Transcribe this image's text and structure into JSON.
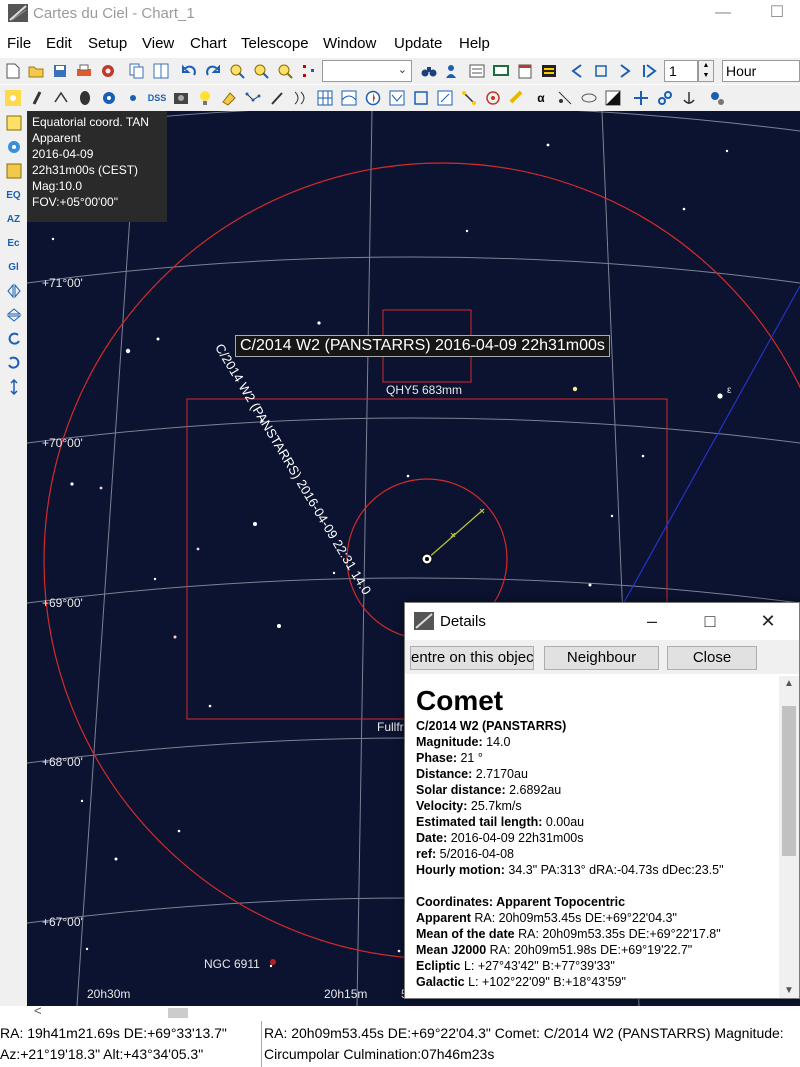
{
  "window": {
    "title": "Cartes du Ciel - Chart_1",
    "minimize_glyph": "—",
    "maximize_glyph": "☐"
  },
  "menu": [
    "File",
    "Edit",
    "Setup",
    "View",
    "Chart",
    "Telescope",
    "Window",
    "Update",
    "Help"
  ],
  "toolbar": {
    "spin_value": "1",
    "time_unit": "Hour",
    "dss_label": "DSS",
    "alpha_label": "α",
    "spin_up": "▲",
    "spin_down": "▼",
    "combo_arrow": "⌄"
  },
  "left_toolbar": [
    "EQ",
    "AZ",
    "Ec",
    "Gl"
  ],
  "chart": {
    "info": [
      "Equatorial coord. TAN",
      "Apparent",
      "2016-04-09",
      "22h31m00s (CEST)",
      "Mag:10.0",
      "FOV:+05°00'00\""
    ],
    "dec_labels": [
      "+71°00'",
      "+70°00'",
      "+69°00'",
      "+68°00'",
      "+67°00'"
    ],
    "ra_labels": [
      "20h30m",
      "20h15m",
      "5"
    ],
    "tooltip": "C/2014 W2 (PANSTARRS) 2016-04-09 22h31m00s",
    "track_label": "C/2014 W2 (PANSTARRS) 2016-04-09 22:31 14.0",
    "fov_small_label": "QHY5 683mm",
    "fov_large_label": "Fullfr",
    "nebula_label": "NGC 6911",
    "star_greek": "ε"
  },
  "status": {
    "left_line1": "RA: 19h41m21.69s DE:+69°33'13.7\"",
    "left_line2": "Az:+21°19'18.3\" Alt:+43°34'05.3\"",
    "right_line1": "RA: 20h09m53.45s DE:+69°22'04.3\"  Comet: C/2014 W2 (PANSTARRS)  Magnitude:",
    "right_line2": "Circumpolar   Culmination:07h46m23s",
    "scroll_arrow": "<"
  },
  "details": {
    "title": "Details",
    "buttons": {
      "centre": "entre on this objec",
      "neighbour": "Neighbour",
      "close": "Close"
    },
    "heading": "Comet",
    "name": "C/2014 W2 (PANSTARRS)",
    "rows": [
      {
        "label": "Magnitude:",
        "value": " 14.0"
      },
      {
        "label": "Phase:",
        "value": " 21 °"
      },
      {
        "label": "Distance:",
        "value": " 2.7170au"
      },
      {
        "label": "Solar distance:",
        "value": " 2.6892au"
      },
      {
        "label": "Velocity:",
        "value": " 25.7km/s"
      },
      {
        "label": "Estimated tail length:",
        "value": " 0.00au"
      },
      {
        "label": "Date:",
        "value": " 2016-04-09 22h31m00s"
      },
      {
        "label": "ref:",
        "value": " 5/2016-04-08"
      },
      {
        "label": "Hourly motion:",
        "value": " 34.3\" PA:313° dRA:-04.73s dDec:23.5\""
      }
    ],
    "coords_heading": "Coordinates: Apparent Topocentric",
    "coords": [
      {
        "label": "Apparent",
        "value": " RA: 20h09m53.45s DE:+69°22'04.3\""
      },
      {
        "label": "Mean of the date",
        "value": " RA: 20h09m53.35s DE:+69°22'17.8\""
      },
      {
        "label": "Mean J2000",
        "value": " RA: 20h09m51.98s DE:+69°19'22.7\""
      },
      {
        "label": "Ecliptic",
        "value": "  L: +27°43'42\" B:+77°39'33\""
      },
      {
        "label": "Galactic",
        "value": "  L: +102°22'09\" B:+18°43'59\""
      }
    ]
  }
}
